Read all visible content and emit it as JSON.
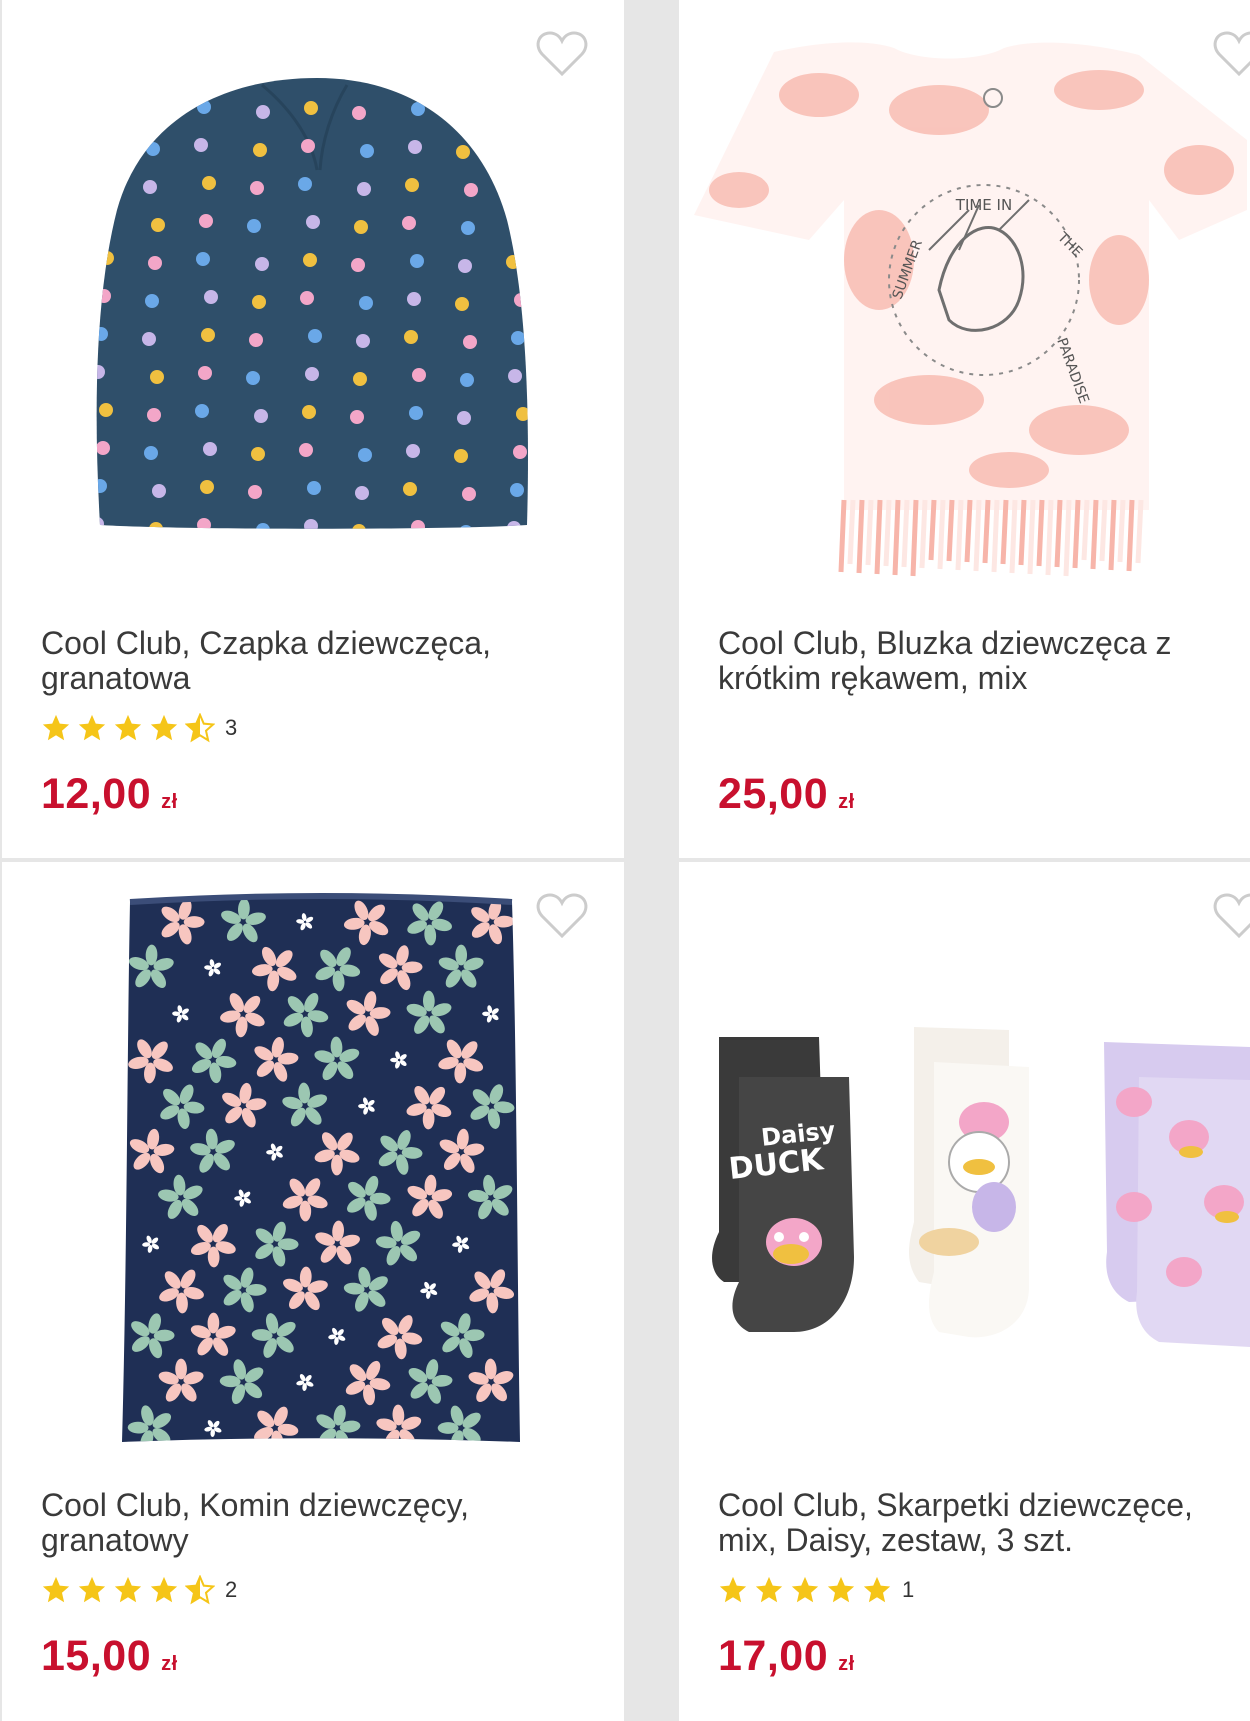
{
  "products": [
    {
      "title": "Cool Club, Czapka dziewczęca, granatowa",
      "rating": {
        "stars": 4.5,
        "count": "3"
      },
      "price": "12,00",
      "currency": "zł"
    },
    {
      "title": "Cool Club, Bluzka dziewczęca z krótkim rękawem, mix",
      "rating": null,
      "price": "25,00",
      "currency": "zł"
    },
    {
      "title": "Cool Club, Komin dziewczęcy, granatowy",
      "rating": {
        "stars": 4.5,
        "count": "2"
      },
      "price": "15,00",
      "currency": "zł"
    },
    {
      "title": "Cool Club, Skarpetki dziewczęce, mix, Daisy, zestaw, 3 szt.",
      "rating": {
        "stars": 5,
        "count": "1"
      },
      "price": "17,00",
      "currency": "zł"
    }
  ],
  "colors": {
    "price": "#c8102e",
    "star": "#f5c518",
    "heart_outline": "#cccccc"
  },
  "icons": [
    "heart-outline-icon",
    "star-icon",
    "half-star-icon"
  ]
}
